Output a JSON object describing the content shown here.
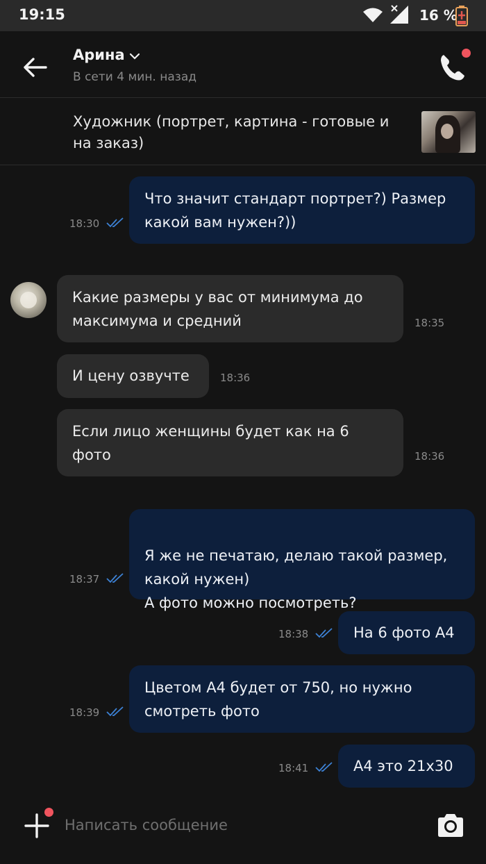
{
  "status_bar": {
    "time": "19:15",
    "battery": "16 %",
    "icons": [
      "wifi-icon",
      "signal-icon",
      "battery-charging-icon"
    ]
  },
  "header": {
    "contact_name": "Арина",
    "status": "В сети 4 мин. назад",
    "icons": [
      "back-arrow-icon",
      "chevron-down-icon",
      "phone-icon"
    ],
    "notification_color": "#f0545e"
  },
  "listing": {
    "title": "Художник (портрет, картина - готовые и на заказ)"
  },
  "messages": [
    {
      "dir": "out",
      "text": "Что значит стандарт портрет?) Размер какой вам нужен?))",
      "time": "18:30",
      "read": true
    },
    {
      "dir": "in",
      "text": "Какие размеры у вас от минимума до максимума и средний",
      "time": "18:35"
    },
    {
      "dir": "in",
      "text": "И цену озвучте",
      "time": "18:36"
    },
    {
      "dir": "in",
      "text": "Если лицо женщины будет как на 6 фото",
      "time": "18:36"
    },
    {
      "dir": "out",
      "text": "Я же не печатаю, делаю такой размер, какой нужен)\nА фото можно посмотреть?",
      "time": "18:37",
      "read": true
    },
    {
      "dir": "out",
      "text": "На 6 фото А4",
      "time": "18:38",
      "read": true
    },
    {
      "dir": "out",
      "text": "Цветом А4 будет от 750, но нужно смотреть фото",
      "time": "18:39",
      "read": true
    },
    {
      "dir": "out",
      "text": "А4 это 21х30",
      "time": "18:41",
      "read": true
    }
  ],
  "composer": {
    "placeholder": "Написать сообщение",
    "icons": [
      "plus-icon",
      "camera-icon"
    ]
  },
  "colors": {
    "outgoing_bubble": "#0d1f3c",
    "incoming_bubble": "#2b2b2b",
    "read_ticks": "#3d82d6"
  }
}
